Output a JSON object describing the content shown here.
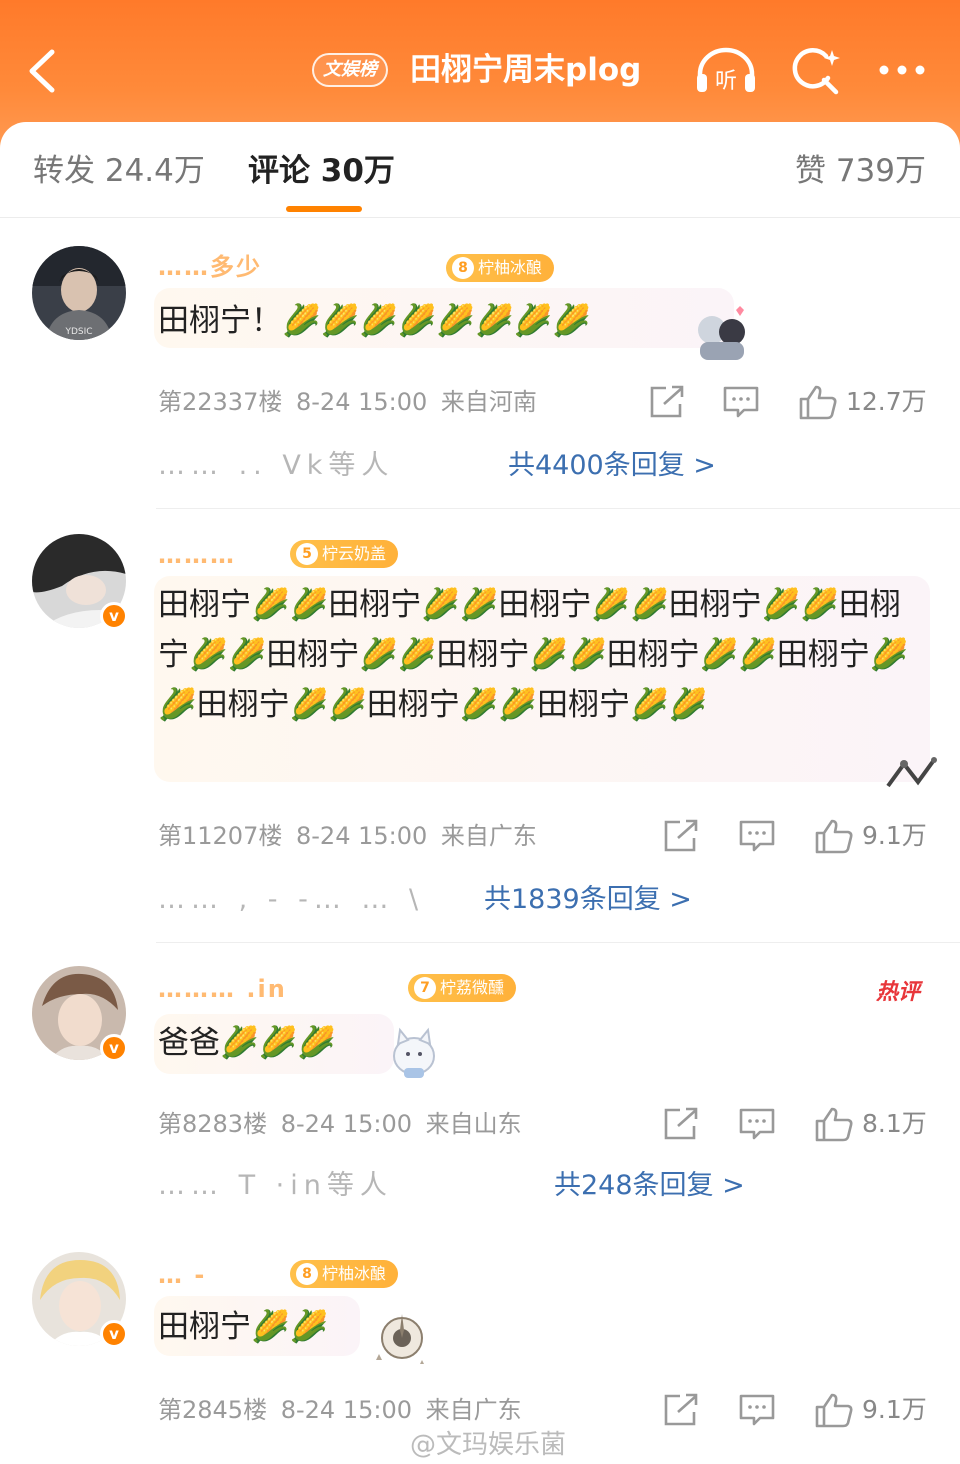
{
  "header": {
    "back_icon": "chevron-left-icon",
    "rank_badge": "文娱榜",
    "title": "田栩宁周末plog",
    "listen_label": "听"
  },
  "tabs": {
    "repost": "转发 24.4万",
    "comment": "评论 30万",
    "like": "赞 739万"
  },
  "comments": [
    {
      "username": "……多少",
      "fan_badge_level": "8",
      "fan_badge_label": "柠柚冰酿",
      "content": "田栩宁！🌽🌽🌽🌽🌽🌽🌽🌽",
      "floor": "第22337楼",
      "time": "8-24 15:00",
      "location": "来自河南",
      "likes": "12.7万",
      "reply_names": "……    ..     Vk等人",
      "reply_summary": "共4400条回复 >"
    },
    {
      "username": "………",
      "fan_badge_level": "5",
      "fan_badge_label": "柠云奶盖",
      "content": "田栩宁🌽🌽田栩宁🌽🌽田栩宁🌽🌽田栩宁🌽🌽田栩宁🌽🌽田栩宁🌽🌽田栩宁🌽🌽田栩宁🌽🌽田栩宁🌽🌽田栩宁🌽🌽田栩宁🌽🌽田栩宁🌽🌽",
      "floor": "第11207楼",
      "time": "8-24 15:00",
      "location": "来自广东",
      "likes": "9.1万",
      "reply_names": "……    ,     - -…    …  \\",
      "reply_summary": "共1839条回复 >"
    },
    {
      "username": "………   .in",
      "fan_badge_level": "7",
      "fan_badge_label": "柠荔微醺",
      "hot_tag": "热评",
      "content": "爸爸🌽🌽🌽",
      "floor": "第8283楼",
      "time": "8-24 15:00",
      "location": "来自山东",
      "likes": "8.1万",
      "reply_names": "……    T        ·in等人",
      "reply_summary": "共248条回复 >"
    },
    {
      "username": "…  -",
      "fan_badge_level": "8",
      "fan_badge_label": "柠柚冰酿",
      "content": "田栩宁🌽🌽",
      "floor": "第2845楼",
      "time": "8-24 15:00",
      "location": "来自广东",
      "likes": "9.1万"
    }
  ],
  "watermark": "@文玛娱乐菌",
  "colors": {
    "brand": "#ff8200",
    "header_gradient_top": "#ff7a2a",
    "link": "#3c6fb0",
    "hot": "#e8363a"
  },
  "icons": [
    "chevron-left-icon",
    "headphones-icon",
    "search-sparkle-icon",
    "more-dots-icon",
    "share-icon",
    "comment-icon",
    "thumbs-up-icon"
  ]
}
